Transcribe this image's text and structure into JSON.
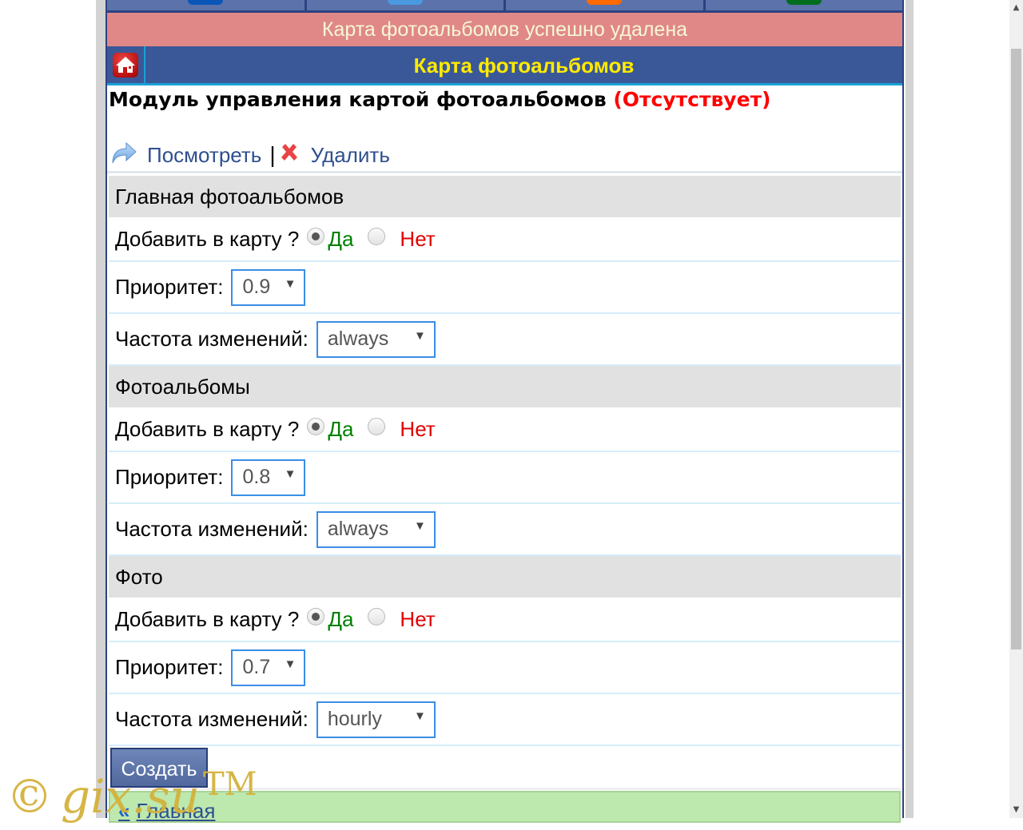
{
  "topnav": {
    "items": [
      {
        "icon": "nav-icon-blue",
        "color": "#0a56b8"
      },
      {
        "icon": "nav-icon-lightblue",
        "color": "#4a9ae0"
      },
      {
        "icon": "nav-icon-orange",
        "color": "#ff6a00"
      },
      {
        "icon": "nav-icon-green",
        "color": "#006e1e"
      }
    ]
  },
  "message": "Карта фотоальбомов успешно удалена",
  "header": {
    "title": "Карта фотоальбомов",
    "home_icon": "home-icon"
  },
  "module": {
    "title": "Модуль управления картой фотоальбомов",
    "status": "(Отсутствует)"
  },
  "actions": {
    "view_label": "Посмотреть",
    "separator": "|",
    "delete_label": "Удалить"
  },
  "labels": {
    "add_to_map": "Добавить в карту ?",
    "yes": "Да",
    "no": "Нет",
    "priority": "Приоритет:",
    "frequency": "Частота изменений:"
  },
  "sections": [
    {
      "title": "Главная фотоальбомов",
      "add_to_map": "yes",
      "priority": "0.9",
      "frequency": "always"
    },
    {
      "title": "Фотоальбомы",
      "add_to_map": "yes",
      "priority": "0.8",
      "frequency": "always"
    },
    {
      "title": "Фото",
      "add_to_map": "yes",
      "priority": "0.7",
      "frequency": "hourly"
    }
  ],
  "submit_label": "Создать",
  "footer": {
    "back_arrow": "«",
    "back_label": "Главная"
  },
  "watermark": {
    "copyright": "©",
    "text": "gix.su",
    "tm": "TM"
  }
}
